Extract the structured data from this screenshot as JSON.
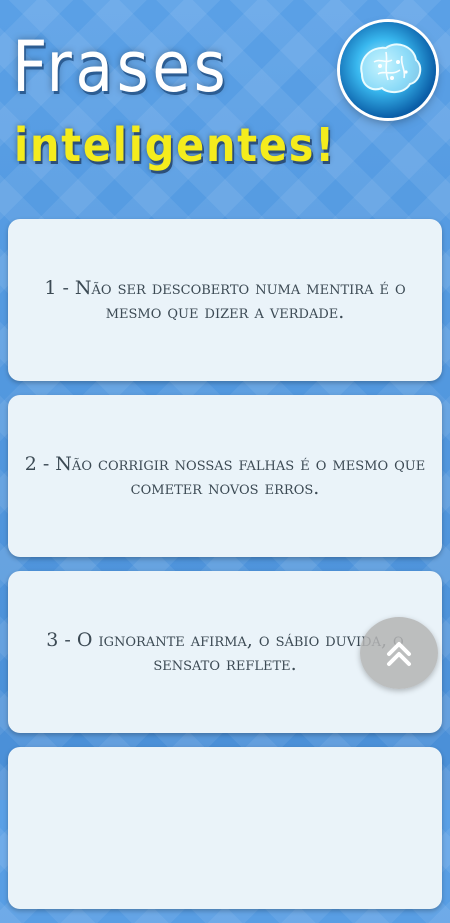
{
  "header": {
    "title_line1": "Frases",
    "title_line2": "inteligentes!",
    "logo_icon": "brain-icon"
  },
  "quotes": [
    {
      "text": "1 - Não ser descoberto numa mentira é o mesmo que dizer a verdade."
    },
    {
      "text": "2 - Não corrigir nossas falhas é o mesmo que cometer novos erros."
    },
    {
      "text": "3 - O ignorante afirma, o sábio duvida, o sensato reflete."
    },
    {
      "text": ""
    }
  ],
  "fab": {
    "icon": "double-chevron-up-icon"
  },
  "colors": {
    "background": "#4a90d6",
    "title_white": "#ffffff",
    "title_yellow": "#f4ec1d",
    "card": "#eaf3f9",
    "card_text": "#3c4a54"
  }
}
